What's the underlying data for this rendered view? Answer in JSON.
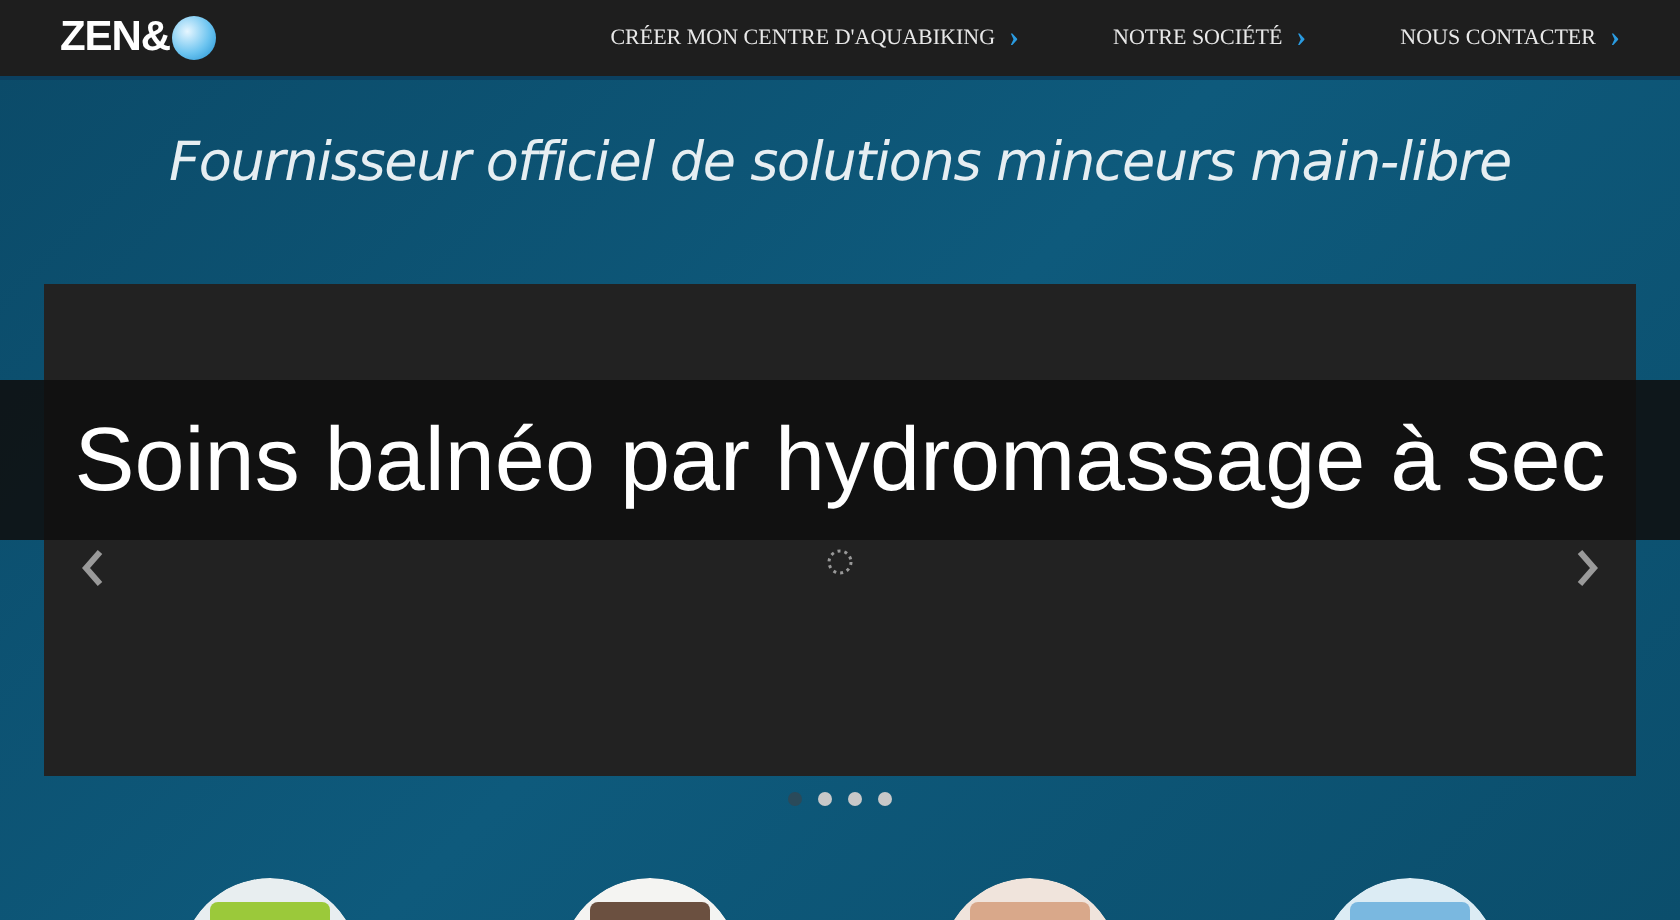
{
  "logo": {
    "text": "ZEN&"
  },
  "nav": [
    {
      "label": "CRÉER MON CENTRE D'AQUABIKING",
      "arrow": "›"
    },
    {
      "label": "NOTRE SOCIÉTÉ",
      "arrow": "›"
    },
    {
      "label": "NOUS CONTACTER",
      "arrow": "›"
    }
  ],
  "tagline": "Fournisseur officiel de solutions minceurs main-libre",
  "slider": {
    "dots": [
      {
        "selected": true
      },
      {
        "selected": false
      },
      {
        "selected": false
      },
      {
        "selected": false
      }
    ]
  },
  "banner": "Soins balnéo par hydromassage à sec"
}
